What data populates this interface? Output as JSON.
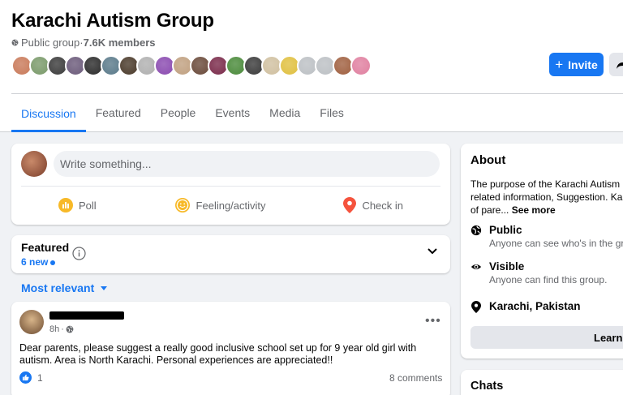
{
  "group": {
    "title": "Karachi Autism Group",
    "privacy": "Public group",
    "separator": " · ",
    "members": "7.6K members"
  },
  "header_actions": {
    "invite_label": "Invite"
  },
  "member_avatar_colors": [
    "#c97a5a",
    "#7a9a6a",
    "#3b3b3b",
    "#6b5a7a",
    "#2b2b2b",
    "#5a7a8a",
    "#4a3a2a",
    "#b0b0b0",
    "#8a4ab0",
    "#c0a080",
    "#6a4a3a",
    "#7a2a4a",
    "#4a8a3a",
    "#3a3a3a",
    "#d0c0a0",
    "#e0c040",
    "#bcc0c4",
    "#bcc0c4",
    "#a06040",
    "#e080a0"
  ],
  "tabs": [
    {
      "label": "Discussion",
      "active": true
    },
    {
      "label": "Featured"
    },
    {
      "label": "People"
    },
    {
      "label": "Events"
    },
    {
      "label": "Media"
    },
    {
      "label": "Files"
    }
  ],
  "composer": {
    "placeholder": "Write something...",
    "actions": [
      {
        "label": "Poll",
        "icon": "poll-icon",
        "color": "#f7b928"
      },
      {
        "label": "Feeling/activity",
        "icon": "smiley-icon",
        "color": "#f7b928"
      },
      {
        "label": "Check in",
        "icon": "location-pin-icon",
        "color": "#f5533d"
      }
    ]
  },
  "featured": {
    "title": "Featured",
    "new_count": "6 new"
  },
  "sort": {
    "label": "Most relevant"
  },
  "post": {
    "time": "8h",
    "text": "Dear parents, please suggest a really good  inclusive school set up for 9 year old girl with autism. Area is North Karachi. Personal experiences are appreciated!!",
    "reaction_count": "1",
    "comments": "8 comments"
  },
  "about": {
    "title": "About",
    "description_lines": [
      "The purpose of the Karachi Autism G",
      "related information, Suggestion. Kar",
      "of pare... "
    ],
    "see_more": "See more",
    "public_label": "Public",
    "public_sub": "Anyone can see who's in the gro",
    "visible_label": "Visible",
    "visible_sub": "Anyone can find this group.",
    "location": "Karachi, Pakistan",
    "learn_more": "Learn m"
  },
  "chats": {
    "title": "Chats"
  },
  "colors": {
    "accent": "#1877f2",
    "background": "#f0f2f5",
    "secondary_text": "#65676b"
  }
}
